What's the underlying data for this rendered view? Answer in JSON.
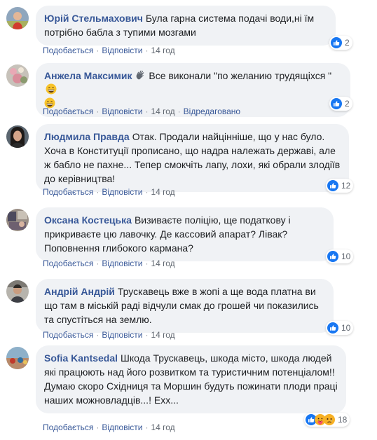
{
  "colors": {
    "accent": "#385898",
    "like": "#1877f2",
    "bubble": "#f0f2f5"
  },
  "action_labels": {
    "like": "Подобається",
    "reply": "Відповісти",
    "sep": "·"
  },
  "comments": [
    {
      "author": "Юрій Стельмахович",
      "text": "Була гарна система подачі води,ні їм потрібно бабла з тупими мозгами",
      "time": "14 год",
      "edited": "",
      "reaction_icons": [
        "like-icon"
      ],
      "reaction_count": "2"
    },
    {
      "author": "Анжела Максимик",
      "author_icon": "waving-hand-icon",
      "text": "Все виконали \"по желанию трудящіхся \"",
      "text_icons": [
        "grinning-face-icon",
        "grinning-face-icon"
      ],
      "time": "14 год",
      "edited": "Відредаговано",
      "reaction_icons": [
        "like-icon"
      ],
      "reaction_count": "2"
    },
    {
      "author": "Людмила Правда",
      "text": "Отак. Продали найцінніше, що у нас було. Хоча в Конституції прописано, що надра належать державі, але ж бабло не пахне... Тепер смокчіть лапу, лохи, які обрали злодіїв до керівництва!",
      "time": "14 год",
      "edited": "",
      "reaction_icons": [
        "like-icon"
      ],
      "reaction_count": "12"
    },
    {
      "author": "Оксана Костецька",
      "text": "Визиваєте полiцiю, ще податкову і прикриваєте цю лавочку. Де кассовий апарат? Лівак? Поповнення глибокого кармана?",
      "time": "14 год",
      "edited": "",
      "reaction_icons": [
        "like-icon"
      ],
      "reaction_count": "10"
    },
    {
      "author": "Андрій Андрій",
      "text": "Трускавець вже в жопі а ще вода платна ви що там в міській раді відчули смак до грошей чи показились та спустіться на землю.",
      "time": "14 год",
      "edited": "",
      "reaction_icons": [
        "like-icon"
      ],
      "reaction_count": "10"
    },
    {
      "author": "Sofia Kantsedal",
      "text": "Шкода Трускавець, шкода місто, шкода людей які працюють над його розвитком та туристичним потенціалом!! Думаю скоро Східниця та Моршин будуть пожинати плоди праці наших можновладців...! Ехх...",
      "time": "14 год",
      "edited": "",
      "reaction_icons": [
        "like-icon",
        "care-icon",
        "sad-icon"
      ],
      "reaction_count": "18"
    }
  ]
}
